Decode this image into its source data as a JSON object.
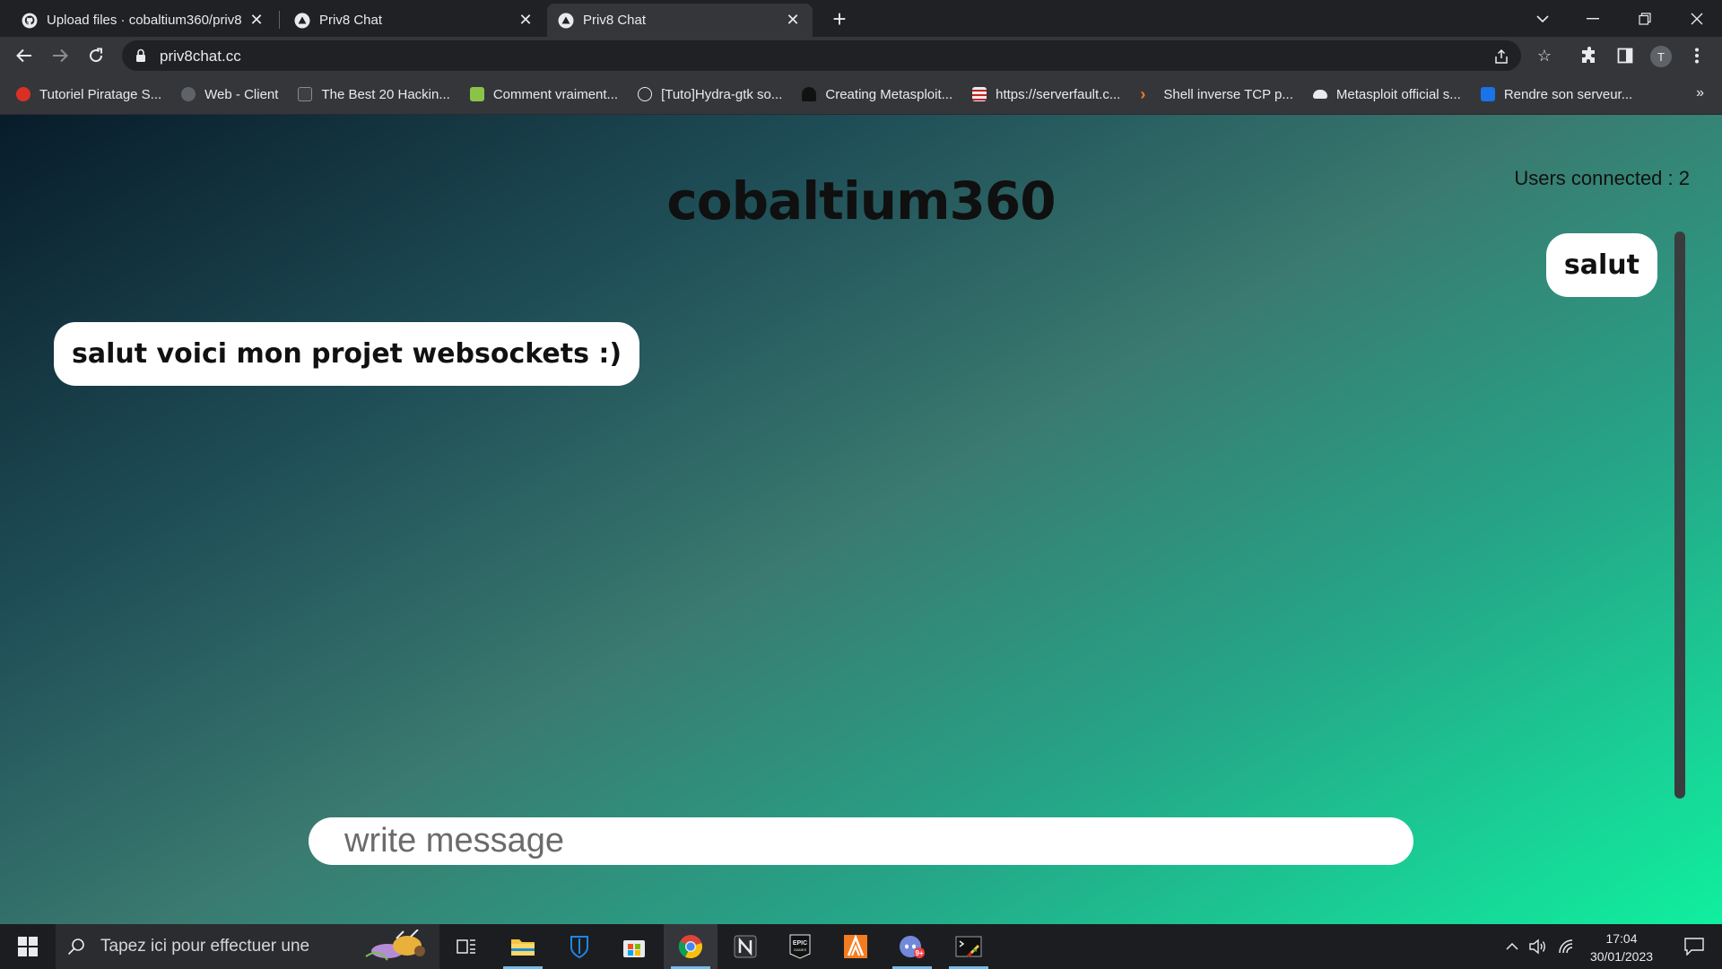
{
  "browser": {
    "tabs": [
      {
        "title": "Upload files · cobaltium360/priv8",
        "favicon": "github-icon",
        "active": false
      },
      {
        "title": "Priv8 Chat",
        "favicon": "triangle-icon",
        "active": false
      },
      {
        "title": "Priv8 Chat",
        "favicon": "triangle-icon",
        "active": true
      }
    ],
    "new_tab_label": "+",
    "url": "priv8chat.cc",
    "profile_initial": "T",
    "bookmarks": [
      {
        "label": "Tutoriel Piratage S...",
        "icon": "apple-icon",
        "color": "#d93025"
      },
      {
        "label": "Web - Client",
        "icon": "circle-icon",
        "color": "#5f6368"
      },
      {
        "label": "The Best 20 Hackin...",
        "icon": "foss-icon",
        "color": "#3c4043"
      },
      {
        "label": "Comment vraiment...",
        "icon": "f-icon",
        "color": "#8bc34a"
      },
      {
        "label": "[Tuto]Hydra-gtk so...",
        "icon": "info-icon",
        "color": "#35363a"
      },
      {
        "label": "Creating Metasploit...",
        "icon": "hacker-icon",
        "color": "#202124"
      },
      {
        "label": "https://serverfault.c...",
        "icon": "serverfault-icon",
        "color": "#e8eaed"
      },
      {
        "label": "Shell inverse TCP p...",
        "icon": "chevron-icon",
        "color": "#f47c20"
      },
      {
        "label": "Metasploit official s...",
        "icon": "cloud-icon",
        "color": "#e8eaed"
      },
      {
        "label": "Rendre son serveur...",
        "icon": "it-icon",
        "color": "#1a73e8"
      }
    ],
    "bookmarks_more": "»"
  },
  "chat": {
    "room_title": "cobaltium360",
    "users_connected": "Users connected : 2",
    "messages": [
      {
        "text": "salut",
        "side": "right"
      },
      {
        "text": "salut voici mon projet websockets :)",
        "side": "left"
      }
    ],
    "composer_placeholder": "write message"
  },
  "taskbar": {
    "search_placeholder": "Tapez ici pour effectuer une",
    "time": "17:04",
    "date": "30/01/2023"
  }
}
